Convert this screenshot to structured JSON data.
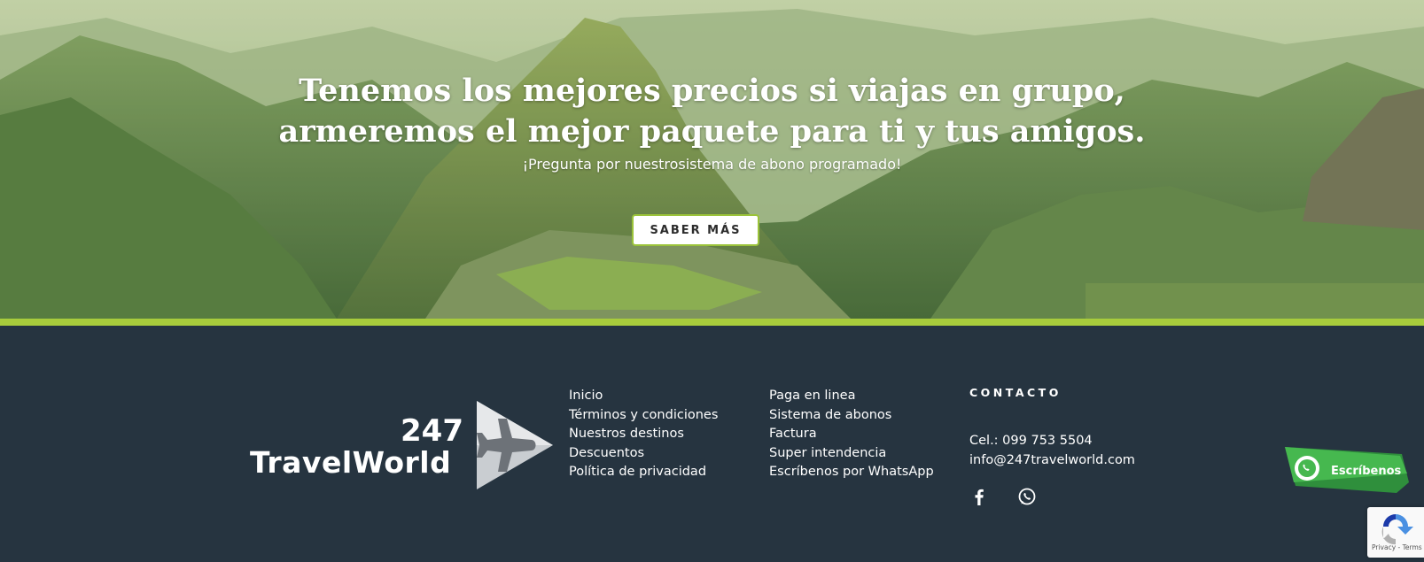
{
  "hero": {
    "title_line1": "Tenemos los mejores precios si viajas en grupo,",
    "title_line2": "armeremos el mejor paquete para ti y tus amigos.",
    "subtitle": "¡Pregunta por nuestrosistema de abono programado!",
    "button_label": "SABER MÁS",
    "accent_color": "#a8cc3c"
  },
  "logo": {
    "line1": "247",
    "line2": "TravelWorld"
  },
  "footer": {
    "links_col1": [
      "Inicio",
      "Términos y condiciones",
      "Nuestros destinos",
      "Descuentos",
      "Política de privacidad"
    ],
    "links_col2": [
      "Paga en linea",
      "Sistema de abonos",
      "Factura",
      "Super intendencia",
      "Escríbenos por WhatsApp"
    ],
    "contact_heading": "CONTACTO",
    "phone": "Cel.: 099 753 5504",
    "email": "info@247travelworld.com",
    "social_icons": [
      "facebook-icon",
      "whatsapp-icon"
    ],
    "background_color": "#263440"
  },
  "whatsapp_float": {
    "label": "Escríbenos",
    "color": "#3fb34f"
  },
  "recaptcha": {
    "text": "Privacy - Terms"
  }
}
